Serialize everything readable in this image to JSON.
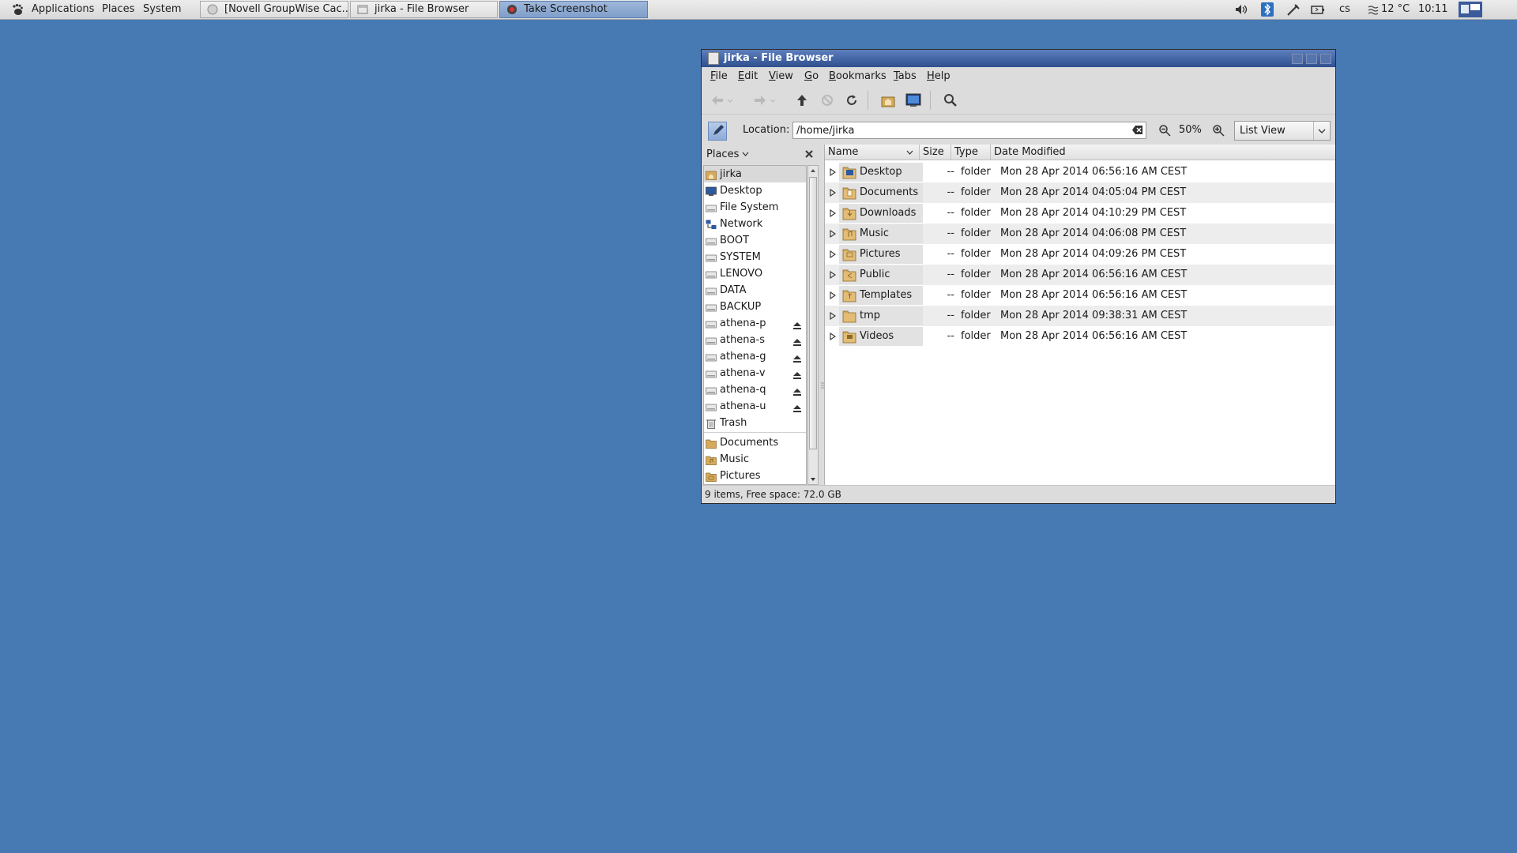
{
  "panel": {
    "menus": [
      "Applications",
      "Places",
      "System"
    ],
    "tasks": [
      {
        "label": "[Novell GroupWise Cac...",
        "icon": "groupwise-icon",
        "active": false
      },
      {
        "label": "jirka - File Browser",
        "icon": "file-browser-icon",
        "active": false
      },
      {
        "label": "Take Screenshot",
        "icon": "screenshot-icon",
        "active": true
      }
    ],
    "keyboard_layout": "cs",
    "weather": "12 °C",
    "clock": "10:11"
  },
  "window": {
    "title": "jirka - File Browser",
    "menus": [
      "File",
      "Edit",
      "View",
      "Go",
      "Bookmarks",
      "Tabs",
      "Help"
    ],
    "location_label": "Location:",
    "location_value": "/home/jirka",
    "zoom": "50%",
    "view_mode": "List View",
    "sidebar_title": "Places",
    "places": [
      {
        "label": "jirka",
        "icon": "home-folder-icon",
        "eject": false
      },
      {
        "label": "Desktop",
        "icon": "desktop-icon",
        "eject": false
      },
      {
        "label": "File System",
        "icon": "drive-icon",
        "eject": false
      },
      {
        "label": "Network",
        "icon": "network-icon",
        "eject": false
      },
      {
        "label": "BOOT",
        "icon": "drive-icon",
        "eject": false
      },
      {
        "label": "SYSTEM",
        "icon": "drive-icon",
        "eject": false
      },
      {
        "label": "LENOVO",
        "icon": "drive-icon",
        "eject": false
      },
      {
        "label": "DATA",
        "icon": "drive-icon",
        "eject": false
      },
      {
        "label": "BACKUP",
        "icon": "drive-icon",
        "eject": false
      },
      {
        "label": "athena-p",
        "icon": "drive-icon",
        "eject": true
      },
      {
        "label": "athena-s",
        "icon": "drive-icon",
        "eject": true
      },
      {
        "label": "athena-g",
        "icon": "drive-icon",
        "eject": true
      },
      {
        "label": "athena-v",
        "icon": "drive-icon",
        "eject": true
      },
      {
        "label": "athena-q",
        "icon": "drive-icon",
        "eject": true
      },
      {
        "label": "athena-u",
        "icon": "drive-icon",
        "eject": true
      },
      {
        "label": "Trash",
        "icon": "trash-icon",
        "eject": false
      }
    ],
    "bookmarks": [
      {
        "label": "Documents",
        "icon": "folder-icon"
      },
      {
        "label": "Music",
        "icon": "music-folder-icon"
      },
      {
        "label": "Pictures",
        "icon": "pictures-folder-icon"
      }
    ],
    "columns": [
      "Name",
      "Size",
      "Type",
      "Date Modified"
    ],
    "files": [
      {
        "name": "Desktop",
        "size": "--",
        "type": "folder",
        "modified": "Mon 28 Apr 2014 06:56:16 AM CEST",
        "icon": "desktop-folder-icon"
      },
      {
        "name": "Documents",
        "size": "--",
        "type": "folder",
        "modified": "Mon 28 Apr 2014 04:05:04 PM CEST",
        "icon": "documents-folder-icon"
      },
      {
        "name": "Downloads",
        "size": "--",
        "type": "folder",
        "modified": "Mon 28 Apr 2014 04:10:29 PM CEST",
        "icon": "downloads-folder-icon"
      },
      {
        "name": "Music",
        "size": "--",
        "type": "folder",
        "modified": "Mon 28 Apr 2014 04:06:08 PM CEST",
        "icon": "music-folder-icon"
      },
      {
        "name": "Pictures",
        "size": "--",
        "type": "folder",
        "modified": "Mon 28 Apr 2014 04:09:26 PM CEST",
        "icon": "pictures-folder-icon"
      },
      {
        "name": "Public",
        "size": "--",
        "type": "folder",
        "modified": "Mon 28 Apr 2014 06:56:16 AM CEST",
        "icon": "public-folder-icon"
      },
      {
        "name": "Templates",
        "size": "--",
        "type": "folder",
        "modified": "Mon 28 Apr 2014 06:56:16 AM CEST",
        "icon": "templates-folder-icon"
      },
      {
        "name": "tmp",
        "size": "--",
        "type": "folder",
        "modified": "Mon 28 Apr 2014 09:38:31 AM CEST",
        "icon": "folder-icon"
      },
      {
        "name": "Videos",
        "size": "--",
        "type": "folder",
        "modified": "Mon 28 Apr 2014 06:56:16 AM CEST",
        "icon": "videos-folder-icon"
      }
    ],
    "status": "9 items, Free space: 72.0 GB"
  },
  "colors": {
    "desktop": "#4779b3",
    "titlebar": "#3a5a9a",
    "folder": "#c9a46a"
  }
}
